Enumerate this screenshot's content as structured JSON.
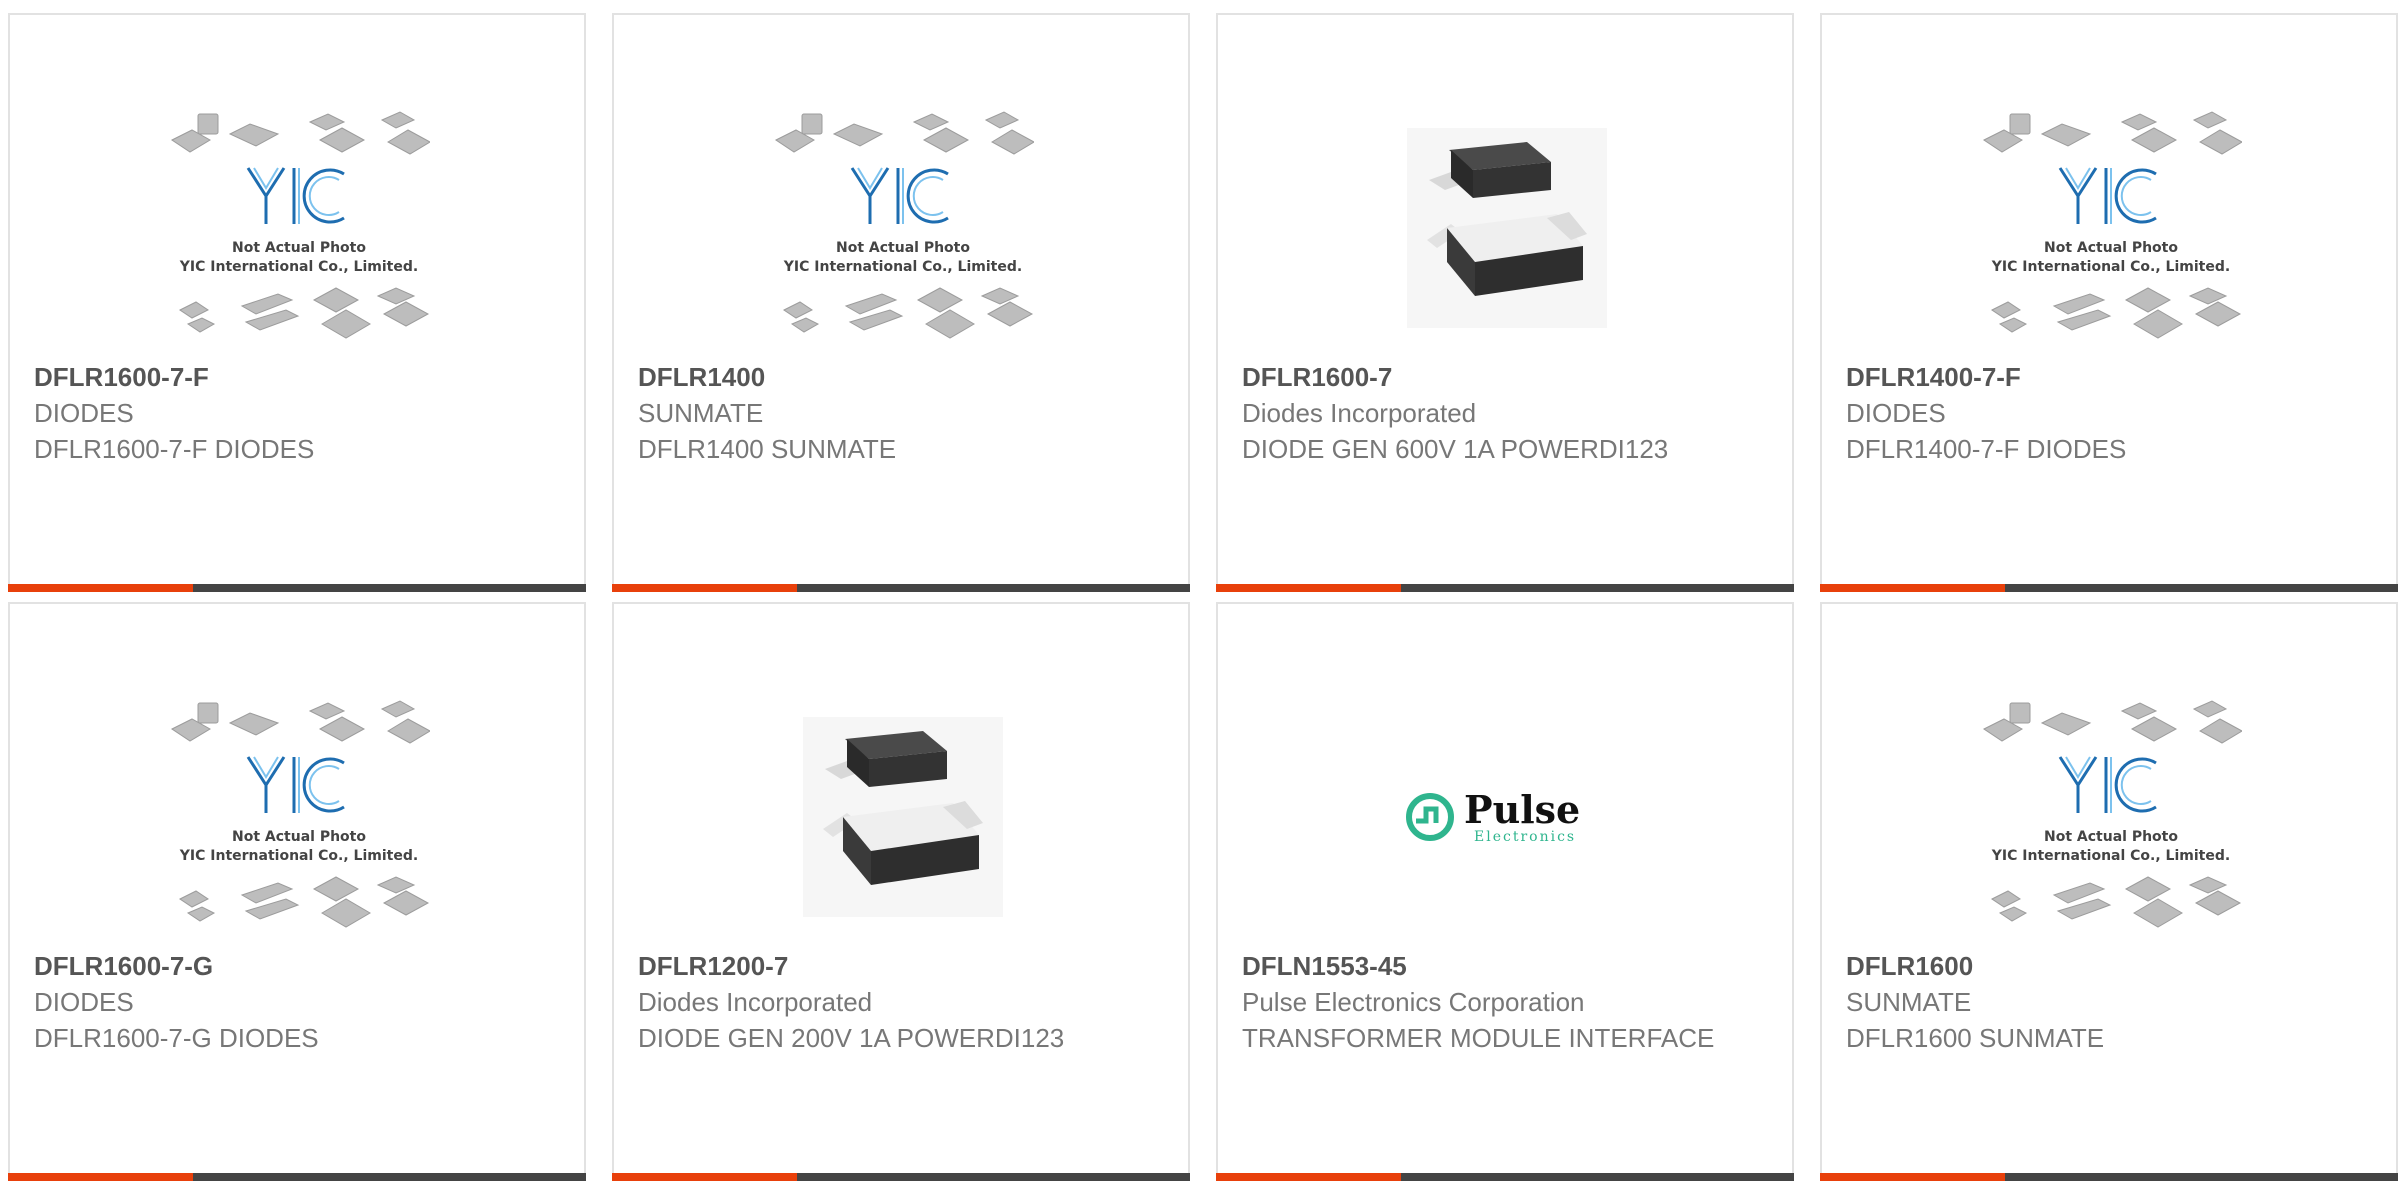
{
  "colors": {
    "accent": "#e8400b",
    "bar": "#444444",
    "title": "#555555",
    "text": "#777777"
  },
  "products": [
    {
      "part": "DFLR1600-7-F",
      "maker": "DIODES",
      "desc": "DFLR1600-7-F DIODES",
      "image": "yic-placeholder",
      "placeholder": {
        "line1": "Not Actual Photo",
        "line2": "YIC International Co., Limited."
      }
    },
    {
      "part": "DFLR1400",
      "maker": "SUNMATE",
      "desc": "DFLR1400 SUNMATE",
      "image": "yic-placeholder",
      "placeholder": {
        "line1": "Not Actual Photo",
        "line2": "YIC International Co., Limited."
      }
    },
    {
      "part": "DFLR1600-7",
      "maker": "Diodes Incorporated",
      "desc": "DIODE GEN 600V 1A POWERDI123",
      "image": "smd-diode-photo"
    },
    {
      "part": "DFLR1400-7-F",
      "maker": "DIODES",
      "desc": "DFLR1400-7-F DIODES",
      "image": "yic-placeholder",
      "placeholder": {
        "line1": "Not Actual Photo",
        "line2": "YIC International Co., Limited."
      }
    },
    {
      "part": "DFLR1600-7-G",
      "maker": "DIODES",
      "desc": "DFLR1600-7-G DIODES",
      "image": "yic-placeholder",
      "placeholder": {
        "line1": "Not Actual Photo",
        "line2": "YIC International Co., Limited."
      }
    },
    {
      "part": "DFLR1200-7",
      "maker": "Diodes Incorporated",
      "desc": "DIODE GEN 200V 1A POWERDI123",
      "image": "smd-diode-photo"
    },
    {
      "part": "DFLN1553-45",
      "maker": "Pulse Electronics Corporation",
      "desc": "TRANSFORMER MODULE INTERFACE",
      "image": "pulse-logo",
      "logo": {
        "name": "Pulse",
        "sub": "Electronics"
      }
    },
    {
      "part": "DFLR1600",
      "maker": "SUNMATE",
      "desc": "DFLR1600 SUNMATE",
      "image": "yic-placeholder",
      "placeholder": {
        "line1": "Not Actual Photo",
        "line2": "YIC International Co., Limited."
      }
    }
  ]
}
